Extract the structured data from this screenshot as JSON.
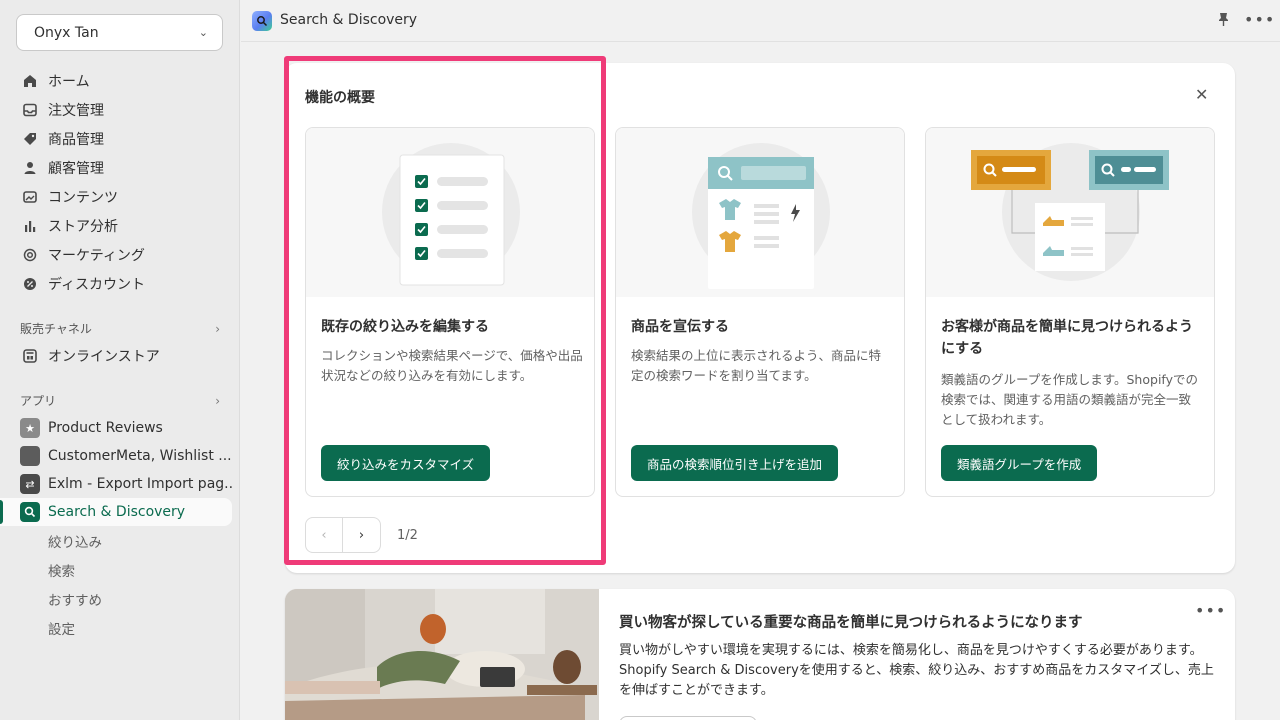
{
  "sidebar": {
    "store_name": "Onyx Tan",
    "nav": [
      {
        "label": "ホーム",
        "icon": "home-icon"
      },
      {
        "label": "注文管理",
        "icon": "inbox-icon"
      },
      {
        "label": "商品管理",
        "icon": "tag-icon"
      },
      {
        "label": "顧客管理",
        "icon": "person-icon"
      },
      {
        "label": "コンテンツ",
        "icon": "image-icon"
      },
      {
        "label": "ストア分析",
        "icon": "bar-chart-icon"
      },
      {
        "label": "マーケティング",
        "icon": "target-icon"
      },
      {
        "label": "ディスカウント",
        "icon": "discount-icon"
      }
    ],
    "sales_channels": {
      "heading": "販売チャネル",
      "items": [
        {
          "label": "オンラインストア",
          "icon": "store-icon"
        }
      ]
    },
    "apps": {
      "heading": "アプリ",
      "items": [
        {
          "label": "Product Reviews",
          "icon": "star-icon",
          "color": "#8a8a8a"
        },
        {
          "label": "CustomerMeta, Wishlist ...",
          "icon": "app-icon",
          "color": "#5c5c5c"
        },
        {
          "label": "Exlm - Export Import pag...",
          "icon": "arrows-icon",
          "color": "#4a4a4a"
        },
        {
          "label": "Search & Discovery",
          "icon": "search-discovery-icon",
          "color": "#0b6b4f"
        }
      ],
      "sub_items": [
        "絞り込み",
        "検索",
        "おすすめ",
        "設定"
      ]
    }
  },
  "topbar": {
    "title": "Search & Discovery"
  },
  "overview": {
    "heading": "機能の概要",
    "cards": [
      {
        "title": "既存の絞り込みを編集する",
        "body": "コレクションや検索結果ページで、価格や出品状況などの絞り込みを有効にします。",
        "button": "絞り込みをカスタマイズ"
      },
      {
        "title": "商品を宣伝する",
        "body": "検索結果の上位に表示されるよう、商品に特定の検索ワードを割り当てます。",
        "button": "商品の検索順位引き上げを追加"
      },
      {
        "title": "お客様が商品を簡単に見つけられるようにする",
        "body": "類義語のグループを作成します。Shopifyでの検索では、関連する用語の類義語が完全一致として扱われます。",
        "button": "類義語グループを作成"
      }
    ],
    "pagination": "1/2"
  },
  "promo": {
    "title": "買い物客が探している重要な商品を簡単に見つけられるようになります",
    "body": "買い物がしやすい環境を実現するには、検索を簡易化し、商品を見つけやすくする必要があります。Shopify Search & Discoveryを使用すると、検索、絞り込み、おすすめ商品をカスタマイズし、売上を伸ばすことができます。"
  },
  "colors": {
    "accent": "#0b6b4f",
    "highlight": "#ef3b78"
  }
}
